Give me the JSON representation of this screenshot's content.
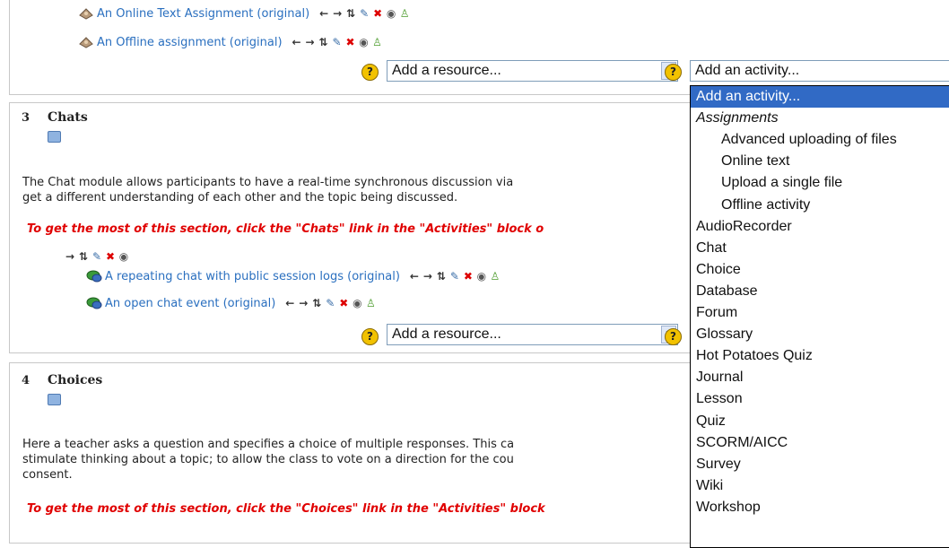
{
  "section2": {
    "items": [
      {
        "label": "An Online Text Assignment (original)",
        "icon": "assignment-icon"
      },
      {
        "label": "An Offline assignment (original)",
        "icon": "assignment-icon"
      }
    ],
    "add_resource_value": "Add a resource...",
    "add_activity_value": "Add an activity..."
  },
  "section3": {
    "number": "3",
    "title": "Chats",
    "desc_line1": "The Chat module allows participants to have a real-time synchronous discussion via",
    "desc_line2": "get a different understanding of each other and the topic being discussed.",
    "tip": "To get the most of this section, click the \"Chats\" link in the \"Activities\" block o",
    "items": [
      {
        "label": "A repeating chat with public session logs (original)",
        "icon": "chat-icon"
      },
      {
        "label": "An open chat event (original)",
        "icon": "chat-icon"
      }
    ],
    "add_resource_value": "Add a resource..."
  },
  "section4": {
    "number": "4",
    "title": "Choices",
    "desc_line1": "Here a teacher asks a question and specifies a choice of multiple responses. This ca",
    "desc_line2": "stimulate thinking about a topic; to allow the class to vote on a direction for the cou",
    "desc_line3": "consent.",
    "tip": "To get the most of this section, click the \"Choices\" link in the \"Activities\" block"
  },
  "activity_dropdown": {
    "options": [
      {
        "label": "Add an activity...",
        "type": "selected"
      },
      {
        "label": "Assignments",
        "type": "group"
      },
      {
        "label": "Advanced uploading of files",
        "type": "sub"
      },
      {
        "label": "Online text",
        "type": "sub"
      },
      {
        "label": "Upload a single file",
        "type": "sub"
      },
      {
        "label": "Offline activity",
        "type": "sub"
      },
      {
        "label": "AudioRecorder",
        "type": "item"
      },
      {
        "label": "Chat",
        "type": "item"
      },
      {
        "label": "Choice",
        "type": "item"
      },
      {
        "label": "Database",
        "type": "item"
      },
      {
        "label": "Forum",
        "type": "item"
      },
      {
        "label": "Glossary",
        "type": "item"
      },
      {
        "label": "Hot Potatoes Quiz",
        "type": "item"
      },
      {
        "label": "Journal",
        "type": "item"
      },
      {
        "label": "Lesson",
        "type": "item"
      },
      {
        "label": "Quiz",
        "type": "item"
      },
      {
        "label": "SCORM/AICC",
        "type": "item"
      },
      {
        "label": "Survey",
        "type": "item"
      },
      {
        "label": "Wiki",
        "type": "item"
      },
      {
        "label": "Workshop",
        "type": "item"
      }
    ]
  },
  "colors": {
    "link": "#2a6fbf",
    "tip": "#e00000",
    "selected_option": "#316ac5"
  }
}
